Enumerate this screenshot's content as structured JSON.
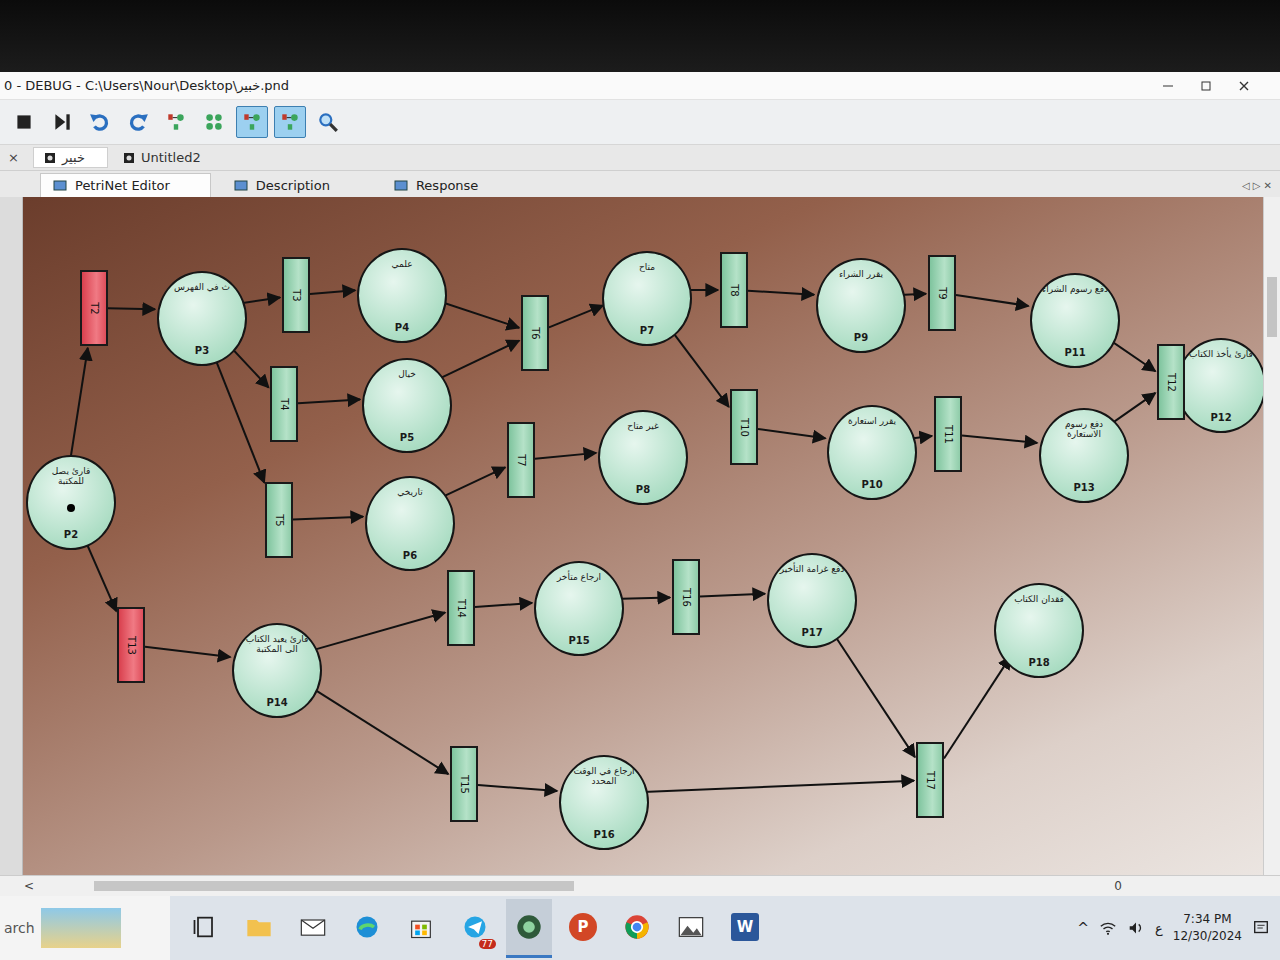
{
  "window": {
    "title": "0 - DEBUG - C:\\Users\\Nour\\Desktop\\خبير.pnd"
  },
  "toolbar": [
    {
      "kind": "stop",
      "pressed": false
    },
    {
      "kind": "step",
      "pressed": false
    },
    {
      "kind": "undo",
      "pressed": false
    },
    {
      "kind": "redo",
      "pressed": false
    },
    {
      "kind": "net",
      "pressed": false
    },
    {
      "kind": "graph",
      "pressed": false
    },
    {
      "kind": "net",
      "pressed": true
    },
    {
      "kind": "net",
      "pressed": true
    },
    {
      "kind": "zoom",
      "pressed": false
    }
  ],
  "doc_tabs": {
    "close": "×",
    "items": [
      {
        "label": "خبير",
        "selected": true
      },
      {
        "label": "Untitled2",
        "selected": false
      }
    ]
  },
  "view_tabs": {
    "items": [
      {
        "label": "PetriNet Editor",
        "selected": true
      },
      {
        "label": "Description",
        "selected": false
      },
      {
        "label": "Response",
        "selected": false
      }
    ],
    "nav": "◁ ▷ ✕"
  },
  "places": [
    {
      "id": "P2",
      "label": "قارئ يصل للمكتبة",
      "tokens": 1
    },
    {
      "id": "P3",
      "label": "ث في الفهرس",
      "tokens": 0
    },
    {
      "id": "P4",
      "label": "علمي",
      "tokens": 0
    },
    {
      "id": "P5",
      "label": "خيال",
      "tokens": 0
    },
    {
      "id": "P6",
      "label": "تاريخي",
      "tokens": 0
    },
    {
      "id": "P7",
      "label": "متاح",
      "tokens": 0
    },
    {
      "id": "P8",
      "label": "غير متاح",
      "tokens": 0
    },
    {
      "id": "P9",
      "label": "يقرر الشراء",
      "tokens": 0
    },
    {
      "id": "P10",
      "label": "يقرر استعارة",
      "tokens": 0
    },
    {
      "id": "P11",
      "label": "دفع رسوم الشراء",
      "tokens": 0
    },
    {
      "id": "P12",
      "label": "قارئ يأخذ الكتاب",
      "tokens": 0
    },
    {
      "id": "P13",
      "label": "دفع رسوم الاستعارة",
      "tokens": 0
    },
    {
      "id": "P14",
      "label": "قارئ يعيد الكتاب الى المكتبة",
      "tokens": 0
    },
    {
      "id": "P15",
      "label": "ارجاع متأخر",
      "tokens": 0
    },
    {
      "id": "P16",
      "label": "ارجاع في الوقت المحدد",
      "tokens": 0
    },
    {
      "id": "P17",
      "label": "دفع غرامة التأخير",
      "tokens": 0
    },
    {
      "id": "P18",
      "label": "فقدان الكتاب",
      "tokens": 0
    }
  ],
  "transitions": [
    {
      "id": "T2",
      "enabled": true
    },
    {
      "id": "T3",
      "enabled": false
    },
    {
      "id": "T4",
      "enabled": false
    },
    {
      "id": "T5",
      "enabled": false
    },
    {
      "id": "T6",
      "enabled": false
    },
    {
      "id": "T7",
      "enabled": false
    },
    {
      "id": "T8",
      "enabled": false
    },
    {
      "id": "T9",
      "enabled": false
    },
    {
      "id": "T10",
      "enabled": false
    },
    {
      "id": "T11",
      "enabled": false
    },
    {
      "id": "T12",
      "enabled": false
    },
    {
      "id": "T13",
      "enabled": true
    },
    {
      "id": "T14",
      "enabled": false
    },
    {
      "id": "T15",
      "enabled": false
    },
    {
      "id": "T16",
      "enabled": false
    },
    {
      "id": "T17",
      "enabled": false
    }
  ],
  "arcs": [
    {
      "from": "P2",
      "to": "T2"
    },
    {
      "from": "T2",
      "to": "P3"
    },
    {
      "from": "P3",
      "to": "T3"
    },
    {
      "from": "P3",
      "to": "T4"
    },
    {
      "from": "P3",
      "to": "T5"
    },
    {
      "from": "T3",
      "to": "P4"
    },
    {
      "from": "T4",
      "to": "P5"
    },
    {
      "from": "T5",
      "to": "P6"
    },
    {
      "from": "P4",
      "to": "T6"
    },
    {
      "from": "P5",
      "to": "T6"
    },
    {
      "from": "T6",
      "to": "P7"
    },
    {
      "from": "P6",
      "to": "T7"
    },
    {
      "from": "T7",
      "to": "P8"
    },
    {
      "from": "P7",
      "to": "T8"
    },
    {
      "from": "T8",
      "to": "P9"
    },
    {
      "from": "P9",
      "to": "T9"
    },
    {
      "from": "T9",
      "to": "P11"
    },
    {
      "from": "P7",
      "to": "T10"
    },
    {
      "from": "T10",
      "to": "P10"
    },
    {
      "from": "P10",
      "to": "T11"
    },
    {
      "from": "T11",
      "to": "P13"
    },
    {
      "from": "P11",
      "to": "T12"
    },
    {
      "from": "P13",
      "to": "T12"
    },
    {
      "from": "T12",
      "to": "P12"
    },
    {
      "from": "P2",
      "to": "T13"
    },
    {
      "from": "T13",
      "to": "P14"
    },
    {
      "from": "P14",
      "to": "T14"
    },
    {
      "from": "T14",
      "to": "P15"
    },
    {
      "from": "P15",
      "to": "T16"
    },
    {
      "from": "T16",
      "to": "P17"
    },
    {
      "from": "P14",
      "to": "T15"
    },
    {
      "from": "T15",
      "to": "P16"
    },
    {
      "from": "P16",
      "to": "T17"
    },
    {
      "from": "P17",
      "to": "T17"
    },
    {
      "from": "T17",
      "to": "P18"
    }
  ],
  "scrollbar": {
    "arrow": "<",
    "value": "0"
  },
  "taskbar": {
    "search": "arch",
    "apps": [
      {
        "kind": "taskview",
        "active": false,
        "glyph": "",
        "badge": ""
      },
      {
        "kind": "explorer",
        "active": false,
        "glyph": "",
        "badge": ""
      },
      {
        "kind": "mail",
        "active": false,
        "glyph": "",
        "badge": ""
      },
      {
        "kind": "edge",
        "active": false,
        "glyph": "",
        "badge": ""
      },
      {
        "kind": "store",
        "active": false,
        "glyph": "",
        "badge": ""
      },
      {
        "kind": "chat",
        "active": false,
        "glyph": "",
        "badge": "77"
      },
      {
        "kind": "petri",
        "active": true,
        "glyph": "",
        "badge": ""
      },
      {
        "kind": "letter",
        "active": false,
        "glyph": "P",
        "badge": ""
      },
      {
        "kind": "chrome",
        "active": false,
        "glyph": "",
        "badge": ""
      },
      {
        "kind": "photos",
        "active": false,
        "glyph": "",
        "badge": ""
      },
      {
        "kind": "word",
        "active": false,
        "glyph": "W",
        "badge": ""
      }
    ],
    "tray": {
      "chevron": "^",
      "lang": "ع",
      "time": "7:34 PM",
      "date": "12/30/2024"
    }
  }
}
